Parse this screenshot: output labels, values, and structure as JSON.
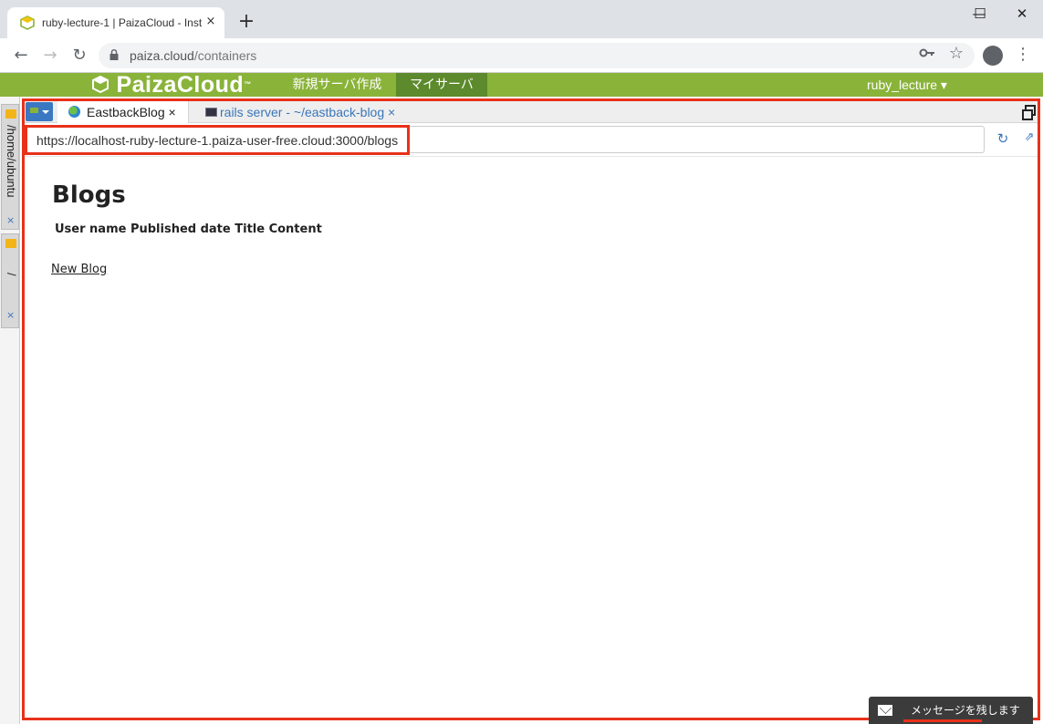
{
  "browser": {
    "tab_title": "ruby-lecture-1 | PaizaCloud - Inst",
    "tab_close": "×",
    "new_tab": "+",
    "window_buttons": {
      "minimize": "—",
      "maximize": "☐",
      "close": "✕"
    },
    "url_host": "paiza.cloud",
    "url_path": "/containers",
    "nav": {
      "back": "←",
      "forward": "→",
      "reload": "↻"
    },
    "icons": {
      "key": "key-icon",
      "star": "star-icon",
      "profile": "profile-icon",
      "menu": "menu-dots-icon"
    },
    "star_glyph": "☆",
    "menu_glyph": "⋮"
  },
  "paiza": {
    "logo": "PaizaCloud",
    "logo_tm": "™",
    "nav_new_server": "新規サーバ作成",
    "nav_my_server": "マイサーバ",
    "user_menu": "ruby_lecture ▾",
    "brand_color": "#8ab33a"
  },
  "sidebar": {
    "items": [
      {
        "label": "/home/ubuntu",
        "close": "×"
      },
      {
        "label": "/",
        "close": "×"
      }
    ]
  },
  "panel": {
    "tabs": [
      {
        "label": "EastbackBlog ×",
        "active": true,
        "icon": "globe-icon"
      },
      {
        "label": "rails server - ~/eastback-blog ×",
        "active": false,
        "icon": "terminal-icon"
      }
    ],
    "browser_url": "https://localhost-ruby-lecture-1.paiza-user-free.cloud:3000/blogs",
    "reload_glyph": "↻",
    "external_glyph": "⇗"
  },
  "page": {
    "heading": "Blogs",
    "table_headers": "User name Published date Title Content",
    "new_blog_link": "New Blog"
  },
  "widget": {
    "message_label": "メッセージを残します"
  }
}
